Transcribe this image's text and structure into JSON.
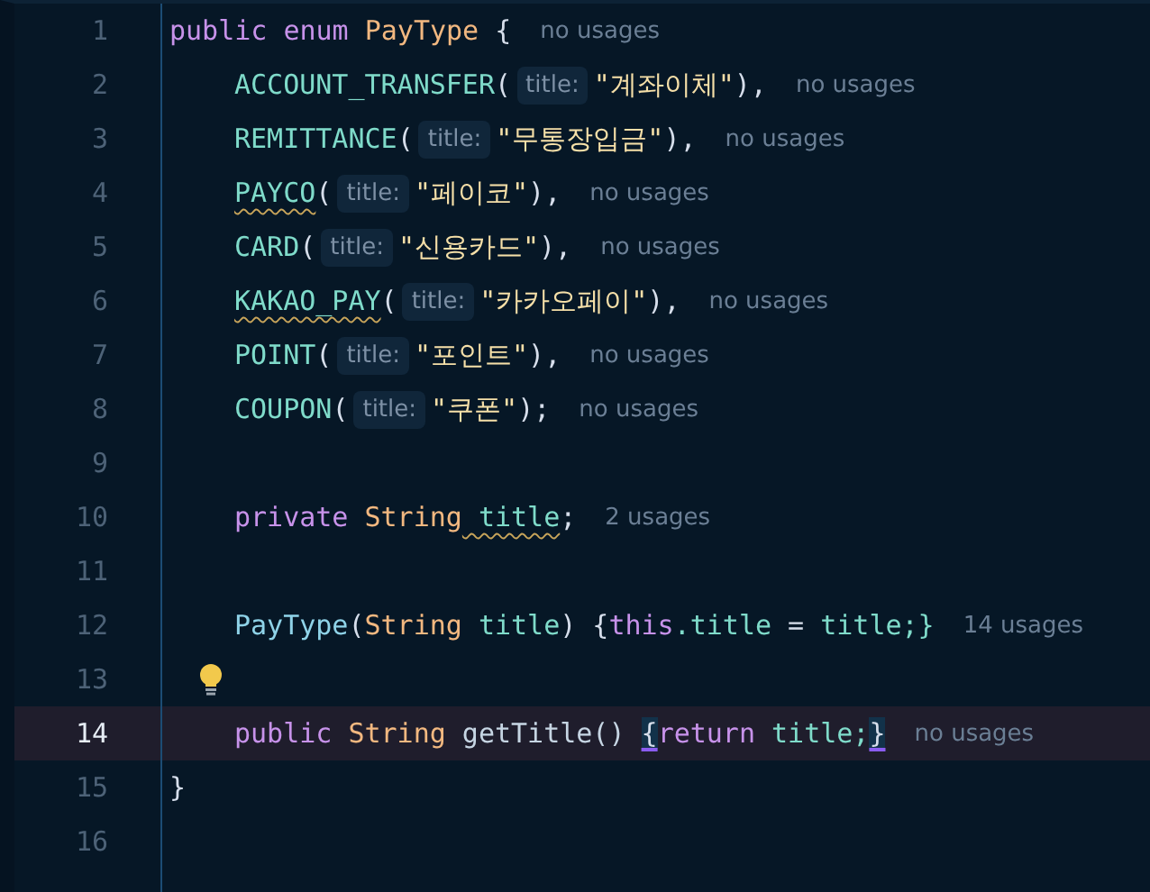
{
  "lines": [
    {
      "number": "1",
      "current": false,
      "bulb": false,
      "tokens": [
        {
          "t": "public",
          "kind": "keyword"
        },
        {
          "t": " enum",
          "kind": "keyword"
        },
        {
          "t": " PayType",
          "kind": "type"
        },
        {
          "t": " {",
          "kind": "punct"
        }
      ],
      "hint": "no usages",
      "children": [
        {
          "number": "2",
          "current": false,
          "bulb": false,
          "tokens": [
            {
              "t": "ACCOUNT_TRANSFER",
              "kind": "constant"
            },
            {
              "t": "(",
              "kind": "punct"
            },
            {
              "t": "title:",
              "kind": "inlay"
            },
            {
              "t": "\"계좌이체\"",
              "kind": "string"
            },
            {
              "t": "),",
              "kind": "punct"
            }
          ],
          "hint": "no usages"
        },
        {
          "number": "3",
          "current": false,
          "bulb": false,
          "tokens": [
            {
              "t": "REMITTANCE",
              "kind": "constant"
            },
            {
              "t": "(",
              "kind": "punct"
            },
            {
              "t": "title:",
              "kind": "inlay"
            },
            {
              "t": "\"무통장입금\"",
              "kind": "string"
            },
            {
              "t": "),",
              "kind": "punct"
            }
          ],
          "hint": "no usages"
        },
        {
          "number": "4",
          "current": false,
          "bulb": false,
          "tokens": [
            {
              "t": "PAYCO",
              "kind": "constant",
              "warn": true
            },
            {
              "t": "(",
              "kind": "punct"
            },
            {
              "t": "title:",
              "kind": "inlay"
            },
            {
              "t": "\"페이코\"",
              "kind": "string"
            },
            {
              "t": "),",
              "kind": "punct"
            }
          ],
          "hint": "no usages"
        },
        {
          "number": "5",
          "current": false,
          "bulb": false,
          "tokens": [
            {
              "t": "CARD",
              "kind": "constant"
            },
            {
              "t": "(",
              "kind": "punct"
            },
            {
              "t": "title:",
              "kind": "inlay"
            },
            {
              "t": "\"신용카드\"",
              "kind": "string"
            },
            {
              "t": "),",
              "kind": "punct"
            }
          ],
          "hint": "no usages"
        },
        {
          "number": "6",
          "current": false,
          "bulb": false,
          "tokens": [
            {
              "t": "KAKAO_PAY",
              "kind": "constant",
              "warn": true
            },
            {
              "t": "(",
              "kind": "punct"
            },
            {
              "t": "title:",
              "kind": "inlay"
            },
            {
              "t": "\"카카오페이\"",
              "kind": "string"
            },
            {
              "t": "),",
              "kind": "punct"
            }
          ],
          "hint": "no usages"
        },
        {
          "number": "7",
          "current": false,
          "bulb": false,
          "tokens": [
            {
              "t": "POINT",
              "kind": "constant"
            },
            {
              "t": "(",
              "kind": "punct"
            },
            {
              "t": "title:",
              "kind": "inlay"
            },
            {
              "t": "\"포인트\"",
              "kind": "string"
            },
            {
              "t": "),",
              "kind": "punct"
            }
          ],
          "hint": "no usages"
        },
        {
          "number": "8",
          "current": false,
          "bulb": false,
          "tokens": [
            {
              "t": "COUPON",
              "kind": "constant"
            },
            {
              "t": "(",
              "kind": "punct"
            },
            {
              "t": "title:",
              "kind": "inlay"
            },
            {
              "t": "\"쿠폰\"",
              "kind": "string"
            },
            {
              "t": ");",
              "kind": "punct"
            }
          ],
          "hint": "no usages"
        },
        {
          "number": "9",
          "current": false,
          "bulb": false
        },
        {
          "number": "10",
          "current": false,
          "bulb": false,
          "tokens": [
            {
              "t": "private",
              "kind": "keyword"
            },
            {
              "t": " String",
              "kind": "type"
            },
            {
              "t": " title",
              "kind": "field",
              "warn": true
            },
            {
              "t": ";",
              "kind": "punct"
            }
          ],
          "hint": "2 usages"
        },
        {
          "number": "11",
          "current": false,
          "bulb": false
        },
        {
          "number": "12",
          "current": false,
          "bulb": false,
          "tokens": [
            {
              "t": "PayType",
              "kind": "method"
            },
            {
              "t": "(",
              "kind": "punct"
            },
            {
              "t": "String",
              "kind": "type"
            },
            {
              "t": " title",
              "kind": "field"
            },
            {
              "t": ") {",
              "kind": "punct"
            },
            {
              "t": "this",
              "kind": "keyword"
            },
            {
              "t": ".title",
              "kind": "field"
            },
            {
              "t": " = ",
              "kind": "punct"
            },
            {
              "t": "title;}",
              "kind": "field"
            }
          ],
          "hint": "14 usages"
        },
        {
          "number": "13",
          "current": false,
          "bulb": true
        },
        {
          "number": "14",
          "current": true,
          "bulb": false,
          "tokens": [
            {
              "t": "public",
              "kind": "keyword"
            },
            {
              "t": " String",
              "kind": "type"
            },
            {
              "t": " getTitle() ",
              "kind": "plain"
            },
            {
              "t": "{",
              "kind": "punct",
              "matched": true
            },
            {
              "t": "return",
              "kind": "keyword"
            },
            {
              "t": " title;",
              "kind": "field"
            },
            {
              "t": "}",
              "kind": "punct",
              "matched": true
            }
          ],
          "hint": "no usages"
        }
      ]
    },
    {
      "number": "15",
      "current": false,
      "bulb": false,
      "tokens": [
        {
          "t": "}",
          "kind": "punct"
        }
      ]
    },
    {
      "number": "16",
      "current": false,
      "bulb": false
    }
  ]
}
